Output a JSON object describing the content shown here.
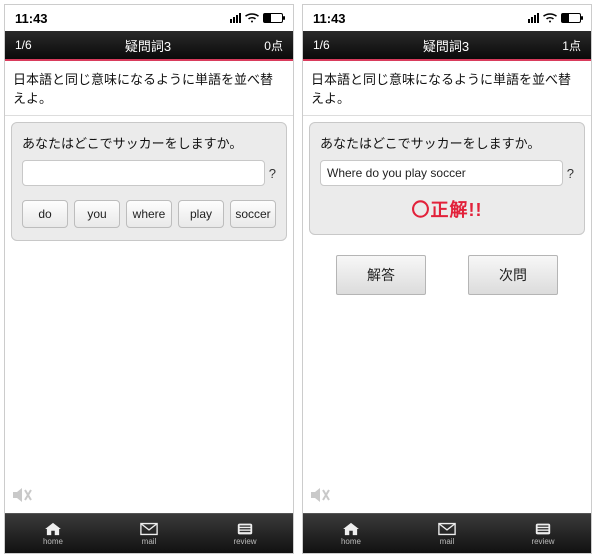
{
  "left": {
    "status": {
      "time": "11:43"
    },
    "header": {
      "progress": "1/6",
      "title": "疑問詞3",
      "score": "0点"
    },
    "instruction": "日本語と同じ意味になるように単語を並べ替えよ。",
    "prompt": "あなたはどこでサッカーをしますか。",
    "answer": "",
    "qmark": "?",
    "choices": [
      "do",
      "you",
      "where",
      "play",
      "soccer"
    ],
    "tabs": {
      "home": "home",
      "mail": "mail",
      "review": "review"
    }
  },
  "right": {
    "status": {
      "time": "11:43"
    },
    "header": {
      "progress": "1/6",
      "title": "疑問詞3",
      "score": "1点"
    },
    "instruction": "日本語と同じ意味になるように単語を並べ替えよ。",
    "prompt": "あなたはどこでサッカーをしますか。",
    "answer": "Where do you play soccer",
    "qmark": "?",
    "result": "〇正解!!",
    "actions": {
      "answer_btn": "解答",
      "next_btn": "次問"
    },
    "tabs": {
      "home": "home",
      "mail": "mail",
      "review": "review"
    }
  }
}
